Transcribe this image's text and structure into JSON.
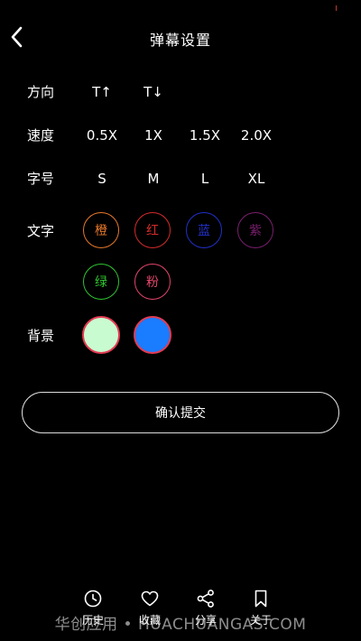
{
  "header": {
    "title": "弹幕设置",
    "back_icon": "chevron-left-icon"
  },
  "settings": {
    "direction": {
      "label": "方向",
      "options": [
        "T↑",
        "T↓"
      ]
    },
    "speed": {
      "label": "速度",
      "options": [
        "0.5X",
        "1X",
        "1.5X",
        "2.0X"
      ]
    },
    "font_size": {
      "label": "字号",
      "options": [
        "S",
        "M",
        "L",
        "XL"
      ]
    },
    "text_color": {
      "label": "文字",
      "options": [
        {
          "label": "橙",
          "color": "#e8782a"
        },
        {
          "label": "红",
          "color": "#d62b2b"
        },
        {
          "label": "蓝",
          "color": "#2230c8"
        },
        {
          "label": "紫",
          "color": "#7a1f6e"
        },
        {
          "label": "绿",
          "color": "#2fc42f"
        },
        {
          "label": "粉",
          "color": "#e2456a"
        }
      ]
    },
    "background": {
      "label": "背景",
      "options": [
        {
          "color": "#c9fbd0"
        },
        {
          "color": "#1a7cff"
        }
      ]
    }
  },
  "submit_label": "确认提交",
  "tabs": [
    {
      "label": "历史",
      "icon": "clock-icon"
    },
    {
      "label": "收藏",
      "icon": "heart-icon"
    },
    {
      "label": "分享",
      "icon": "share-icon"
    },
    {
      "label": "关于",
      "icon": "bookmark-icon"
    }
  ],
  "watermark": "华创应用 • HUACHUANGAS.COM"
}
